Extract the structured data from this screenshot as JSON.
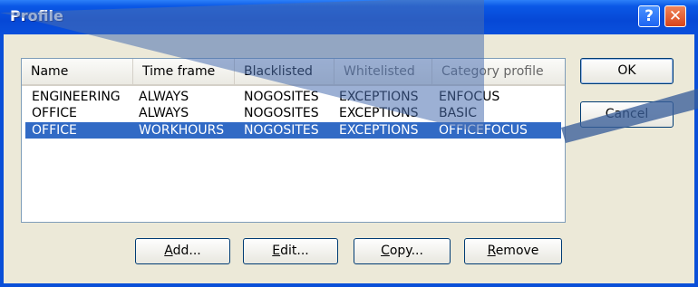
{
  "window": {
    "title": "Profile"
  },
  "titlebar_buttons": {
    "help": "?",
    "close": "✕"
  },
  "columns": [
    "Name",
    "Time frame",
    "Blacklisted",
    "Whitelisted",
    "Category profile"
  ],
  "rows": [
    {
      "name": "ENGINEERING",
      "time_frame": "ALWAYS",
      "blacklisted": "NOGOSITES",
      "whitelisted": "EXCEPTIONS",
      "category_profile": "ENFOCUS",
      "selected": false
    },
    {
      "name": "OFFICE",
      "time_frame": "ALWAYS",
      "blacklisted": "NOGOSITES",
      "whitelisted": "EXCEPTIONS",
      "category_profile": "BASIC",
      "selected": false
    },
    {
      "name": "OFFICE",
      "time_frame": "WORKHOURS",
      "blacklisted": "NOGOSITES",
      "whitelisted": "EXCEPTIONS",
      "category_profile": "OFFICEFOCUS",
      "selected": true
    }
  ],
  "buttons": {
    "ok": "OK",
    "cancel": "Cancel",
    "add": {
      "accel": "A",
      "rest": "dd..."
    },
    "edit": {
      "accel": "E",
      "rest": "dit..."
    },
    "copy": {
      "accel": "C",
      "rest": "opy..."
    },
    "remove": {
      "accel": "R",
      "rest": "emove"
    }
  },
  "colors": {
    "titlebar": "#0a58e6",
    "selection": "#316ac5",
    "face": "#ece9d8",
    "callout": "#4a6fb0"
  }
}
